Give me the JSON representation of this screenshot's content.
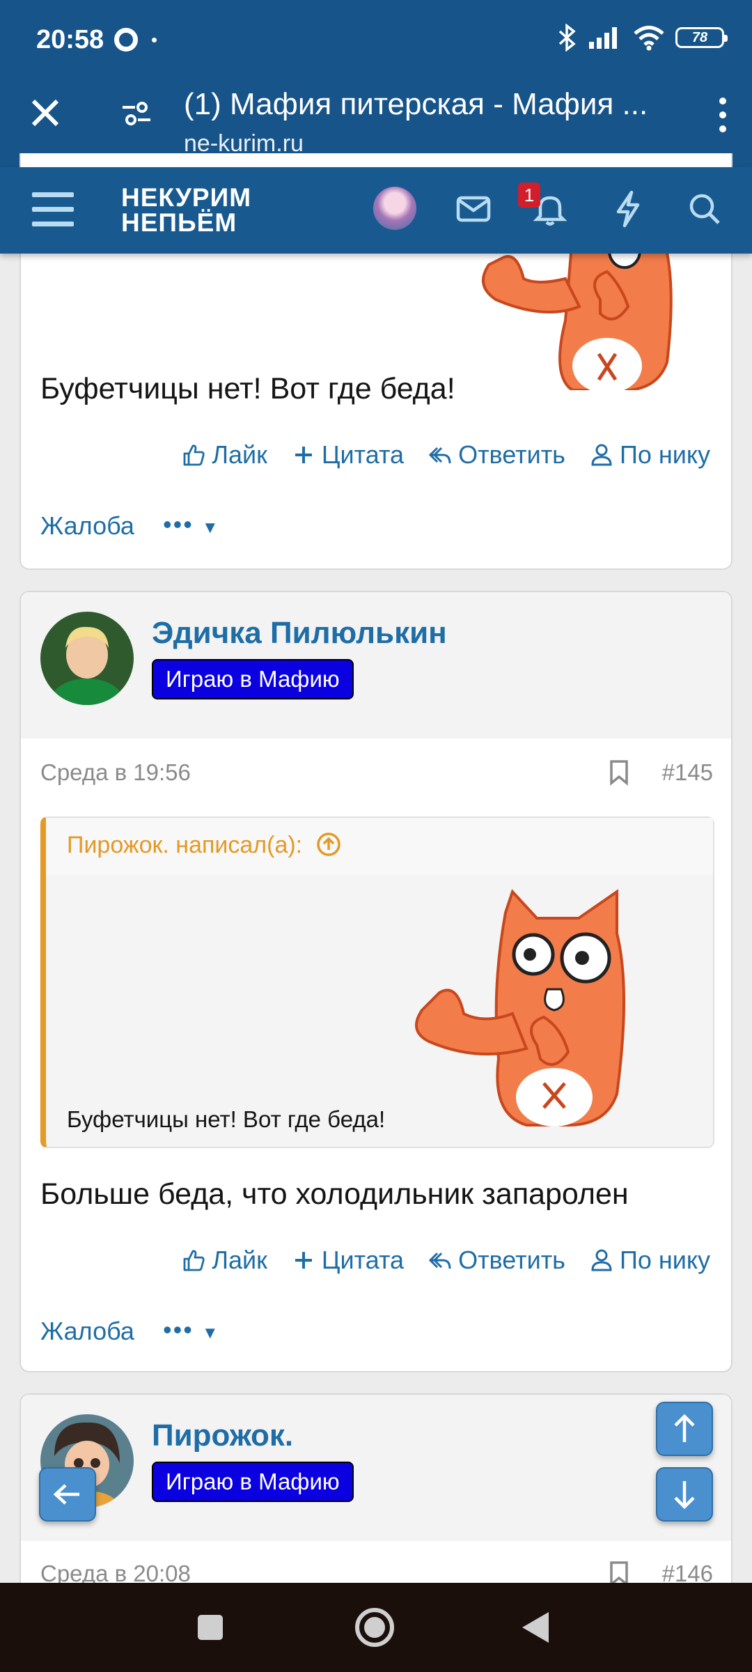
{
  "status": {
    "time": "20:58",
    "battery": "78"
  },
  "browser": {
    "title": "(1) Мафия питерская - Мафия ...",
    "domain": "ne-kurim.ru"
  },
  "site": {
    "logo_line1": "НЕКУРИМ",
    "logo_line2": "НЕПЬЁМ",
    "notifications_count": "1"
  },
  "post1": {
    "text": "Буфетчицы нет! Вот где беда!",
    "actions": {
      "like": "Лайк",
      "quote": "Цитата",
      "reply": "Ответить",
      "by_nick": "По нику"
    },
    "report": "Жалоба",
    "more": "•••"
  },
  "post2": {
    "author": "Эдичка Пилюлькин",
    "role": "Играю в Мафию",
    "date": "Среда в 19:56",
    "number": "#145",
    "quote_title": "Пирожок. написал(а):",
    "quote_text": "Буфетчицы нет! Вот где беда!",
    "text": "Больше беда, что холодильник запаролен",
    "actions": {
      "like": "Лайк",
      "quote": "Цитата",
      "reply": "Ответить",
      "by_nick": "По нику"
    },
    "report": "Жалоба",
    "more": "•••"
  },
  "post3": {
    "author": "Пирожок.",
    "role": "Играю в Мафию",
    "date": "Среда в 20:08",
    "number": "#146"
  },
  "colors": {
    "brand": "#185a8f",
    "link": "#1e6da6",
    "quote_accent": "#e39a26",
    "role_badge": "#0a00e0"
  }
}
